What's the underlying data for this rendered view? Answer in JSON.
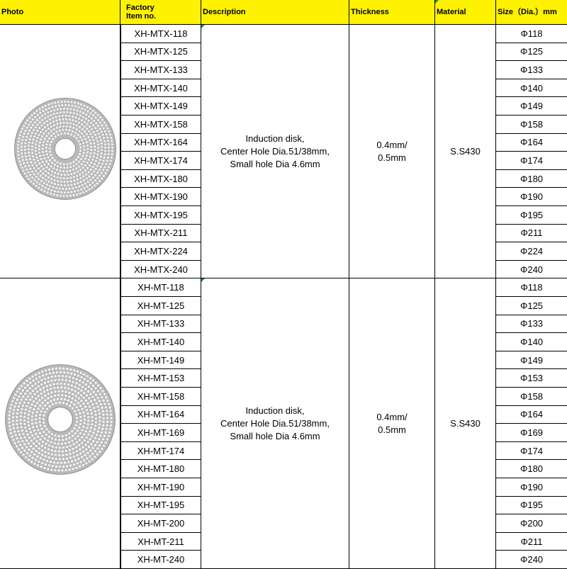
{
  "headers": {
    "photo": "Photo",
    "item_no": "Factory\nItem no.",
    "description": "Description",
    "thickness": "Thickness",
    "material": "Material",
    "size": "Size（Dia.）mm"
  },
  "groups": [
    {
      "photo_icon": "perforated-disk-icon",
      "description": "Induction disk,\nCenter Hole Dia.51/38mm,\nSmall hole Dia 4.6mm",
      "thickness": "0.4mm/\n0.5mm",
      "material": "S.S430",
      "rows": [
        {
          "item": "XH-MTX-118",
          "size": "Φ118"
        },
        {
          "item": "XH-MTX-125",
          "size": "Φ125"
        },
        {
          "item": "XH-MTX-133",
          "size": "Φ133"
        },
        {
          "item": "XH-MTX-140",
          "size": "Φ140"
        },
        {
          "item": "XH-MTX-149",
          "size": "Φ149"
        },
        {
          "item": "XH-MTX-158",
          "size": "Φ158"
        },
        {
          "item": "XH-MTX-164",
          "size": "Φ164"
        },
        {
          "item": "XH-MTX-174",
          "size": "Φ174"
        },
        {
          "item": "XH-MTX-180",
          "size": "Φ180"
        },
        {
          "item": "XH-MTX-190",
          "size": "Φ190"
        },
        {
          "item": "XH-MTX-195",
          "size": "Φ195"
        },
        {
          "item": "XH-MTX-211",
          "size": "Φ211"
        },
        {
          "item": "XH-MTX-224",
          "size": "Φ224"
        },
        {
          "item": "XH-MTX-240",
          "size": "Φ240"
        }
      ]
    },
    {
      "photo_icon": "perforated-disk-icon",
      "description": "Induction disk,\nCenter Hole Dia.51/38mm,\nSmall hole Dia 4.6mm",
      "thickness": "0.4mm/\n0.5mm",
      "material": "S.S430",
      "rows": [
        {
          "item": "XH-MT-118",
          "size": "Φ118"
        },
        {
          "item": "XH-MT-125",
          "size": "Φ125"
        },
        {
          "item": "XH-MT-133",
          "size": "Φ133"
        },
        {
          "item": "XH-MT-140",
          "size": "Φ140"
        },
        {
          "item": "XH-MT-149",
          "size": "Φ149"
        },
        {
          "item": "XH-MT-153",
          "size": "Φ153"
        },
        {
          "item": "XH-MT-158",
          "size": "Φ158"
        },
        {
          "item": "XH-MT-164",
          "size": "Φ164"
        },
        {
          "item": "XH-MT-169",
          "size": "Φ169"
        },
        {
          "item": "XH-MT-174",
          "size": "Φ174"
        },
        {
          "item": "XH-MT-180",
          "size": "Φ180"
        },
        {
          "item": "XH-MT-190",
          "size": "Φ190"
        },
        {
          "item": "XH-MT-195",
          "size": "Φ195"
        },
        {
          "item": "XH-MT-200",
          "size": "Φ200"
        },
        {
          "item": "XH-MT-211",
          "size": "Φ211"
        },
        {
          "item": "XH-MT-240",
          "size": "Φ240"
        }
      ]
    }
  ],
  "colors": {
    "header_bg": "#fff200",
    "marker": "#1f8c3a",
    "disk_metal": "#b9b9b9"
  }
}
